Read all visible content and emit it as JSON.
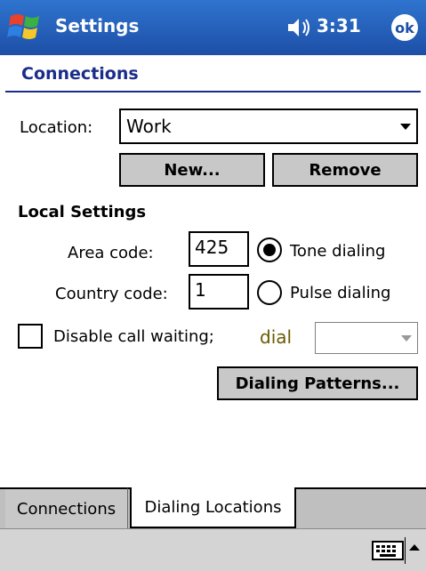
{
  "titlebar": {
    "app_title": "Settings",
    "time": "3:31",
    "ok_label": "ok"
  },
  "page": {
    "title": "Connections"
  },
  "location": {
    "label": "Location:",
    "value": "Work"
  },
  "buttons": {
    "new_label": "New...",
    "remove_label": "Remove",
    "dialing_patterns_label": "Dialing Patterns..."
  },
  "local_settings": {
    "heading": "Local Settings",
    "area_code_label": "Area code:",
    "area_code_value": "425",
    "country_code_label": "Country code:",
    "country_code_value": "1",
    "tone_label": "Tone dialing",
    "pulse_label": "Pulse dialing",
    "selected_dialing": "tone"
  },
  "call_waiting": {
    "label": "Disable call waiting;",
    "checked": false,
    "dial_label": "dial",
    "dial_value": ""
  },
  "tabs": [
    {
      "label": "Connections",
      "active": false
    },
    {
      "label": "Dialing Locations",
      "active": true
    }
  ],
  "colors": {
    "titlebar": "#1d4fa7",
    "heading": "#1b2d8a",
    "dial_label": "#6b5a00"
  }
}
